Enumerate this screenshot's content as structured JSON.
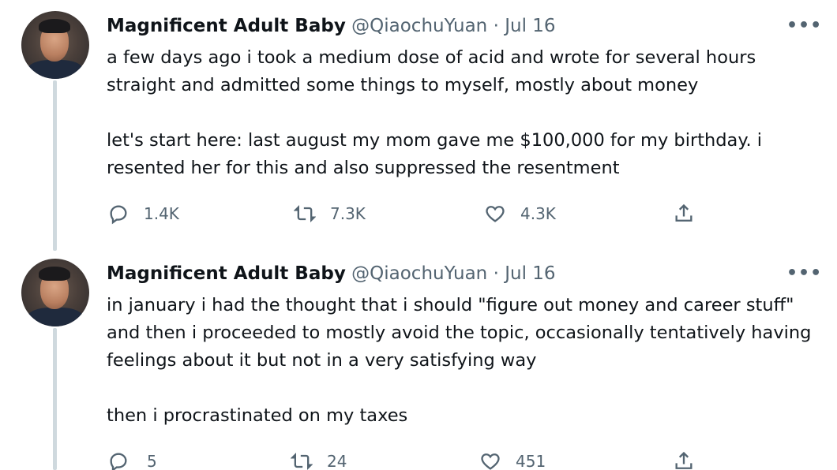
{
  "tweets": [
    {
      "author_name": "Magnificent Adult Baby",
      "handle": "@QiaochuYuan",
      "separator": "·",
      "date": "Jul 16",
      "more": "•••",
      "paragraphs": [
        "a few days ago i took a medium dose of acid and wrote for several hours straight and admitted some things to myself, mostly about money",
        "let's start here: last august my mom gave me $100,000 for my birthday. i resented her for this and also suppressed the resentment"
      ],
      "replies": "1.4K",
      "retweets": "7.3K",
      "likes": "4.3K",
      "icons": [
        "reply-icon",
        "retweet-icon",
        "like-icon",
        "share-icon"
      ]
    },
    {
      "author_name": "Magnificent Adult Baby",
      "handle": "@QiaochuYuan",
      "separator": "·",
      "date": "Jul 16",
      "more": "•••",
      "paragraphs": [
        "in january i had the thought that i should \"figure out money and career stuff\" and then i proceeded to mostly avoid the topic, occasionally tentatively having feelings about it but not in a very satisfying way",
        "then i procrastinated on my taxes"
      ],
      "replies": "5",
      "retweets": "24",
      "likes": "451",
      "icons": [
        "reply-icon",
        "retweet-icon",
        "like-icon",
        "share-icon"
      ]
    }
  ],
  "colors": {
    "text": "#0f1419",
    "secondary": "#536471",
    "thread_line": "#cfd9de",
    "background": "#ffffff"
  }
}
